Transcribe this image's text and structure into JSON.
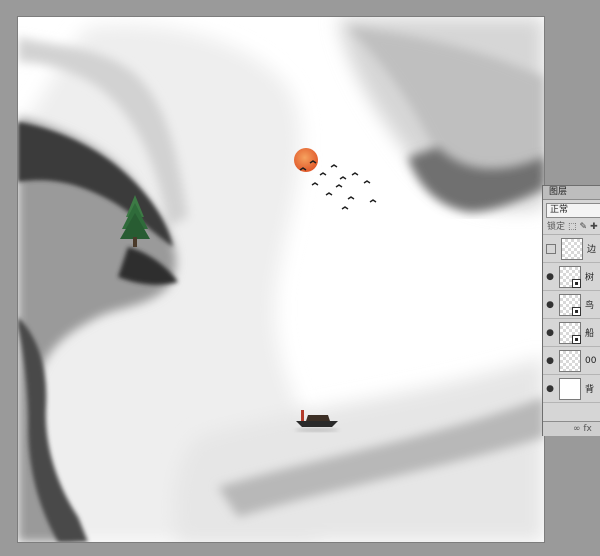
{
  "layers_panel": {
    "tab_label": "图层",
    "blend_mode": "正常",
    "lock_label": "锁定",
    "lock_tools": [
      "⬚",
      "✎",
      "✚"
    ],
    "layers": [
      {
        "name": "边",
        "visible": false,
        "smart": false,
        "white": false
      },
      {
        "name": "树",
        "visible": true,
        "smart": true,
        "white": false
      },
      {
        "name": "鸟",
        "visible": true,
        "smart": true,
        "white": false
      },
      {
        "name": "船",
        "visible": true,
        "smart": true,
        "white": false
      },
      {
        "name": "00",
        "visible": true,
        "smart": false,
        "white": false
      },
      {
        "name": "背",
        "visible": true,
        "smart": false,
        "white": true
      }
    ],
    "footer_icons": [
      "∞",
      "fx"
    ]
  },
  "colors": {
    "workspace_bg": "#9a9a9a",
    "canvas_bg": "#ffffff",
    "ink_dark": "#2b2b2b",
    "sun_orange": "#e8743a",
    "tree_green": "#2f6b3a"
  }
}
